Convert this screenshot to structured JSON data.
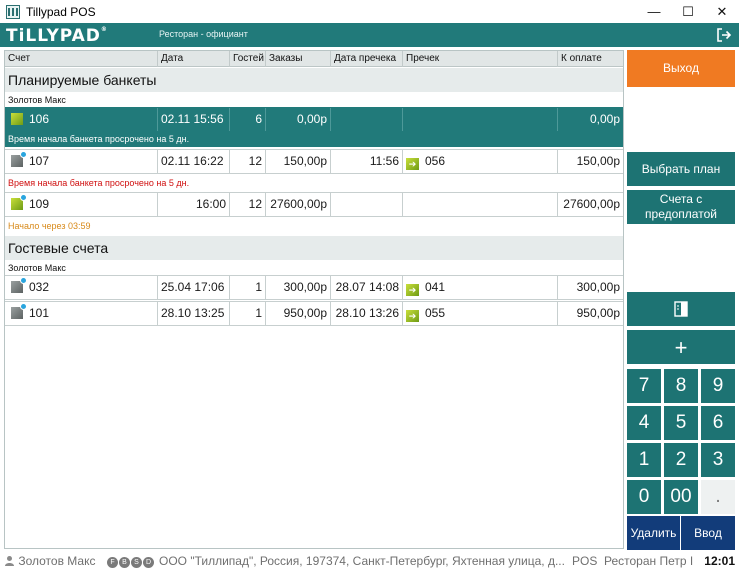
{
  "window": {
    "title": "Tillypad POS",
    "minimize": "—",
    "maximize": "☐",
    "close": "✕"
  },
  "header": {
    "logo": "TiLLYPAD",
    "subtitle": "Ресторан - официант",
    "logout_icon": "logout-icon"
  },
  "columns": {
    "account": "Счет",
    "date": "Дата",
    "guests": "Гостей",
    "orders": "Заказы",
    "precheck_date": "Дата пречека",
    "precheck": "Пречек",
    "to_pay": "К оплате"
  },
  "banquets": {
    "title": "Планируемые банкеты",
    "waiter": "Золотов Макс",
    "rows": [
      {
        "account": "106",
        "date": "02.11 15:56",
        "guests": "6",
        "orders": "0,00р",
        "precheck_date": "",
        "precheck": "",
        "to_pay": "0,00р",
        "note": "Время начала банкета просрочено на 5 дн."
      },
      {
        "account": "107",
        "date": "02.11 16:22",
        "guests": "12",
        "orders": "150,00р",
        "precheck_date": "11:56",
        "precheck": "056",
        "to_pay": "150,00р",
        "note": "Время начала банкета просрочено на 5 дн."
      },
      {
        "account": "109",
        "date": "16:00",
        "guests": "12",
        "orders": "27600,00р",
        "precheck_date": "",
        "precheck": "",
        "to_pay": "27600,00р",
        "note": "Начало через 03:59"
      }
    ]
  },
  "guest_accounts": {
    "title": "Гостевые счета",
    "waiter": "Золотов Макс",
    "rows": [
      {
        "account": "032",
        "date": "25.04 17:06",
        "guests": "1",
        "orders": "300,00р",
        "precheck_date": "28.07 14:08",
        "precheck": "041",
        "to_pay": "300,00р"
      },
      {
        "account": "101",
        "date": "28.10 13:25",
        "guests": "1",
        "orders": "950,00р",
        "precheck_date": "28.10 13:26",
        "precheck": "055",
        "to_pay": "950,00р"
      }
    ]
  },
  "sidebar": {
    "exit": "Выход",
    "choose_plan": "Выбрать план",
    "prepaid_accounts": "Счета с предоплатой",
    "plus": "+",
    "delete": "Удалить",
    "enter": "Ввод"
  },
  "keypad": {
    "k7": "7",
    "k8": "8",
    "k9": "9",
    "k4": "4",
    "k5": "5",
    "k6": "6",
    "k1": "1",
    "k2": "2",
    "k3": "3",
    "k0": "0",
    "k00": "00",
    "kdot": "."
  },
  "status": {
    "user": "Золотов Макс",
    "badges": [
      "F",
      "B",
      "S",
      "D"
    ],
    "company": "ООО \"Тиллипад\", Россия, 197374, Санкт-Петербург, Яхтенная улица, д...",
    "mode": "POS",
    "terminal": "Ресторан Петр I",
    "time": "12:01"
  },
  "colors": {
    "teal": "#217a7a",
    "orange": "#f07a22",
    "navy": "#123c7a",
    "warning_red": "#d01010",
    "warning_orange": "#d88a1a"
  }
}
